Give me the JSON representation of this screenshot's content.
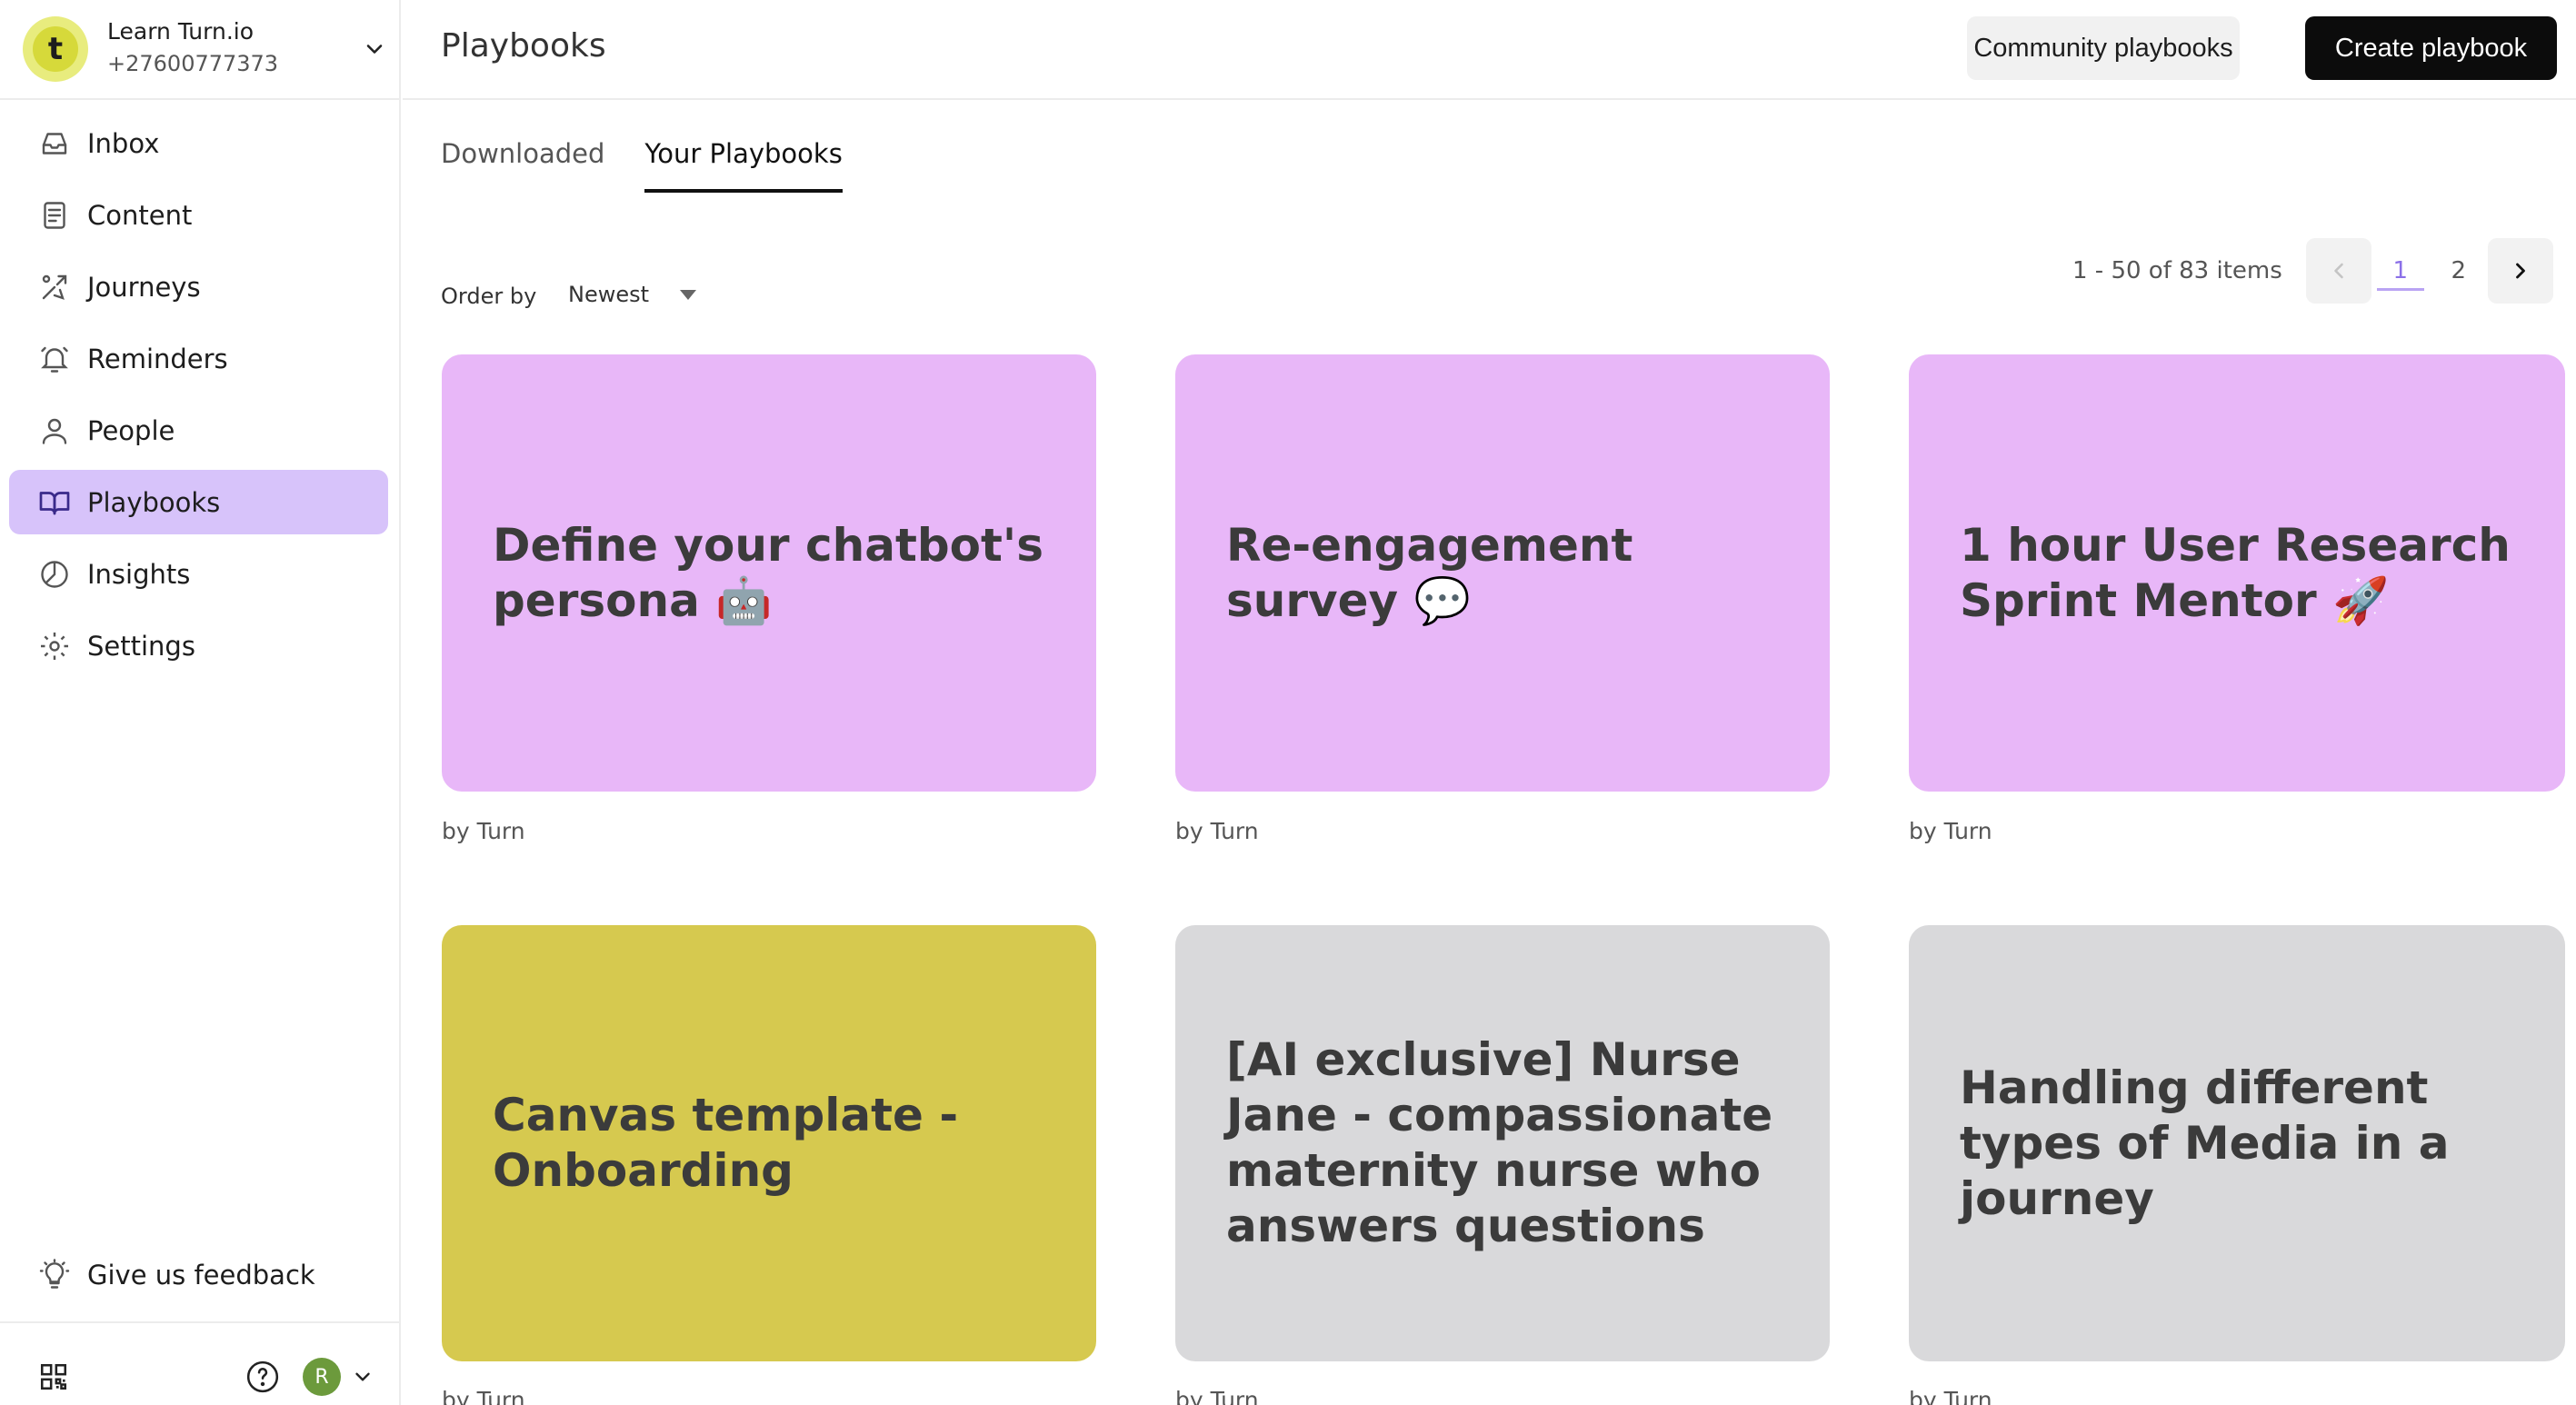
{
  "org": {
    "initial": "t",
    "name": "Learn Turn.io",
    "phone": "+27600777373"
  },
  "nav": {
    "items": [
      {
        "label": "Inbox",
        "icon": "inbox-icon"
      },
      {
        "label": "Content",
        "icon": "content-icon"
      },
      {
        "label": "Journeys",
        "icon": "journeys-icon"
      },
      {
        "label": "Reminders",
        "icon": "reminders-icon"
      },
      {
        "label": "People",
        "icon": "people-icon"
      },
      {
        "label": "Playbooks",
        "icon": "playbooks-icon",
        "active": true
      },
      {
        "label": "Insights",
        "icon": "insights-icon"
      },
      {
        "label": "Settings",
        "icon": "settings-icon"
      }
    ],
    "feedback_label": "Give us feedback"
  },
  "user": {
    "initial": "R",
    "avatar_color": "#6c9a3c"
  },
  "header": {
    "title": "Playbooks",
    "community_label": "Community playbooks",
    "create_label": "Create playbook"
  },
  "tabs": [
    {
      "label": "Downloaded",
      "active": false
    },
    {
      "label": "Your Playbooks",
      "active": true
    }
  ],
  "order": {
    "label": "Order by",
    "value": "Newest"
  },
  "pagination": {
    "info": "1 - 50 of 83 items",
    "pages": [
      "1",
      "2"
    ],
    "current": "1"
  },
  "colors": {
    "accent": "#d7c3fa",
    "pink_card": "#e8b7f8",
    "yellow_card": "#d6c94f",
    "grey_card": "#d9d9db"
  },
  "playbooks": [
    {
      "title": "Define your chatbot's persona 🤖",
      "author": "by Turn",
      "color": "#e8b7f8"
    },
    {
      "title": "Re-engagement survey 💬",
      "author": "by Turn",
      "color": "#e8b7f8"
    },
    {
      "title": "1 hour User Research Sprint Mentor 🚀",
      "author": "by Turn",
      "color": "#e8b7f8"
    },
    {
      "title": "Canvas template - Onboarding",
      "author": "by Turn",
      "color": "#d6c94f"
    },
    {
      "title": "[AI exclusive] Nurse Jane - compassionate maternity nurse who answers questions",
      "author": "by Turn",
      "color": "#d9d9db"
    },
    {
      "title": "Handling different types of Media in a journey",
      "author": "by Turn",
      "color": "#d9d9db"
    }
  ]
}
